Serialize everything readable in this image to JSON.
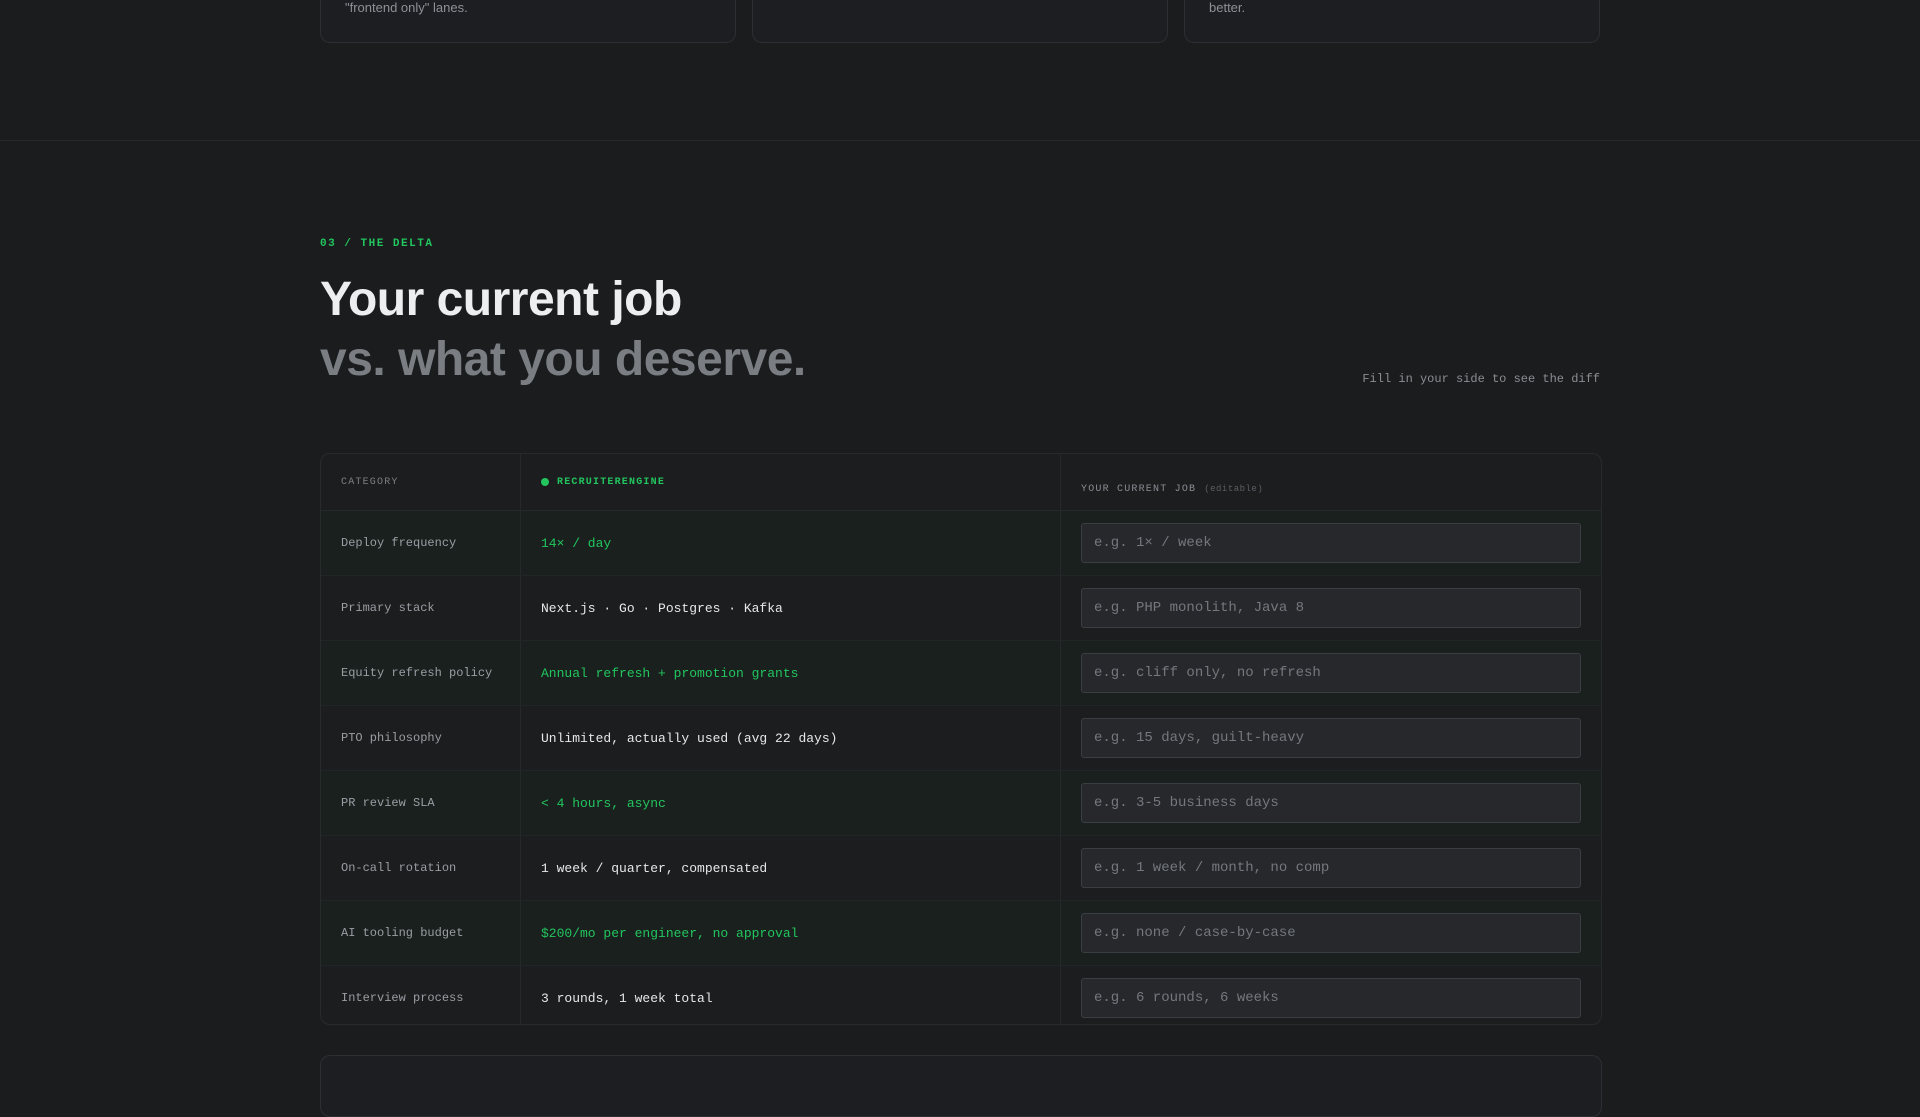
{
  "top_cards": [
    {
      "text": "\"frontend only\" lanes."
    },
    {
      "text": ""
    },
    {
      "text": "better."
    }
  ],
  "section": {
    "eyebrow": "03 / THE DELTA",
    "title_line1": "Your current job",
    "title_line2": "vs. what you deserve.",
    "hint": "Fill in your side to see the diff"
  },
  "table": {
    "headers": {
      "category": "CATEGORY",
      "company": "RECRUITERENGINE",
      "yours": "YOUR CURRENT JOB",
      "editable_tag": "(editable)"
    },
    "rows": [
      {
        "category": "Deploy frequency",
        "value": "14× / day",
        "placeholder": "e.g. 1× / week"
      },
      {
        "category": "Primary stack",
        "value": "Next.js · Go · Postgres · Kafka",
        "placeholder": "e.g. PHP monolith, Java 8"
      },
      {
        "category": "Equity refresh policy",
        "value": "Annual refresh + promotion grants",
        "placeholder": "e.g. cliff only, no refresh"
      },
      {
        "category": "PTO philosophy",
        "value": "Unlimited, actually used (avg 22 days)",
        "placeholder": "e.g. 15 days, guilt-heavy"
      },
      {
        "category": "PR review SLA",
        "value": "< 4 hours, async",
        "placeholder": "e.g. 3-5 business days"
      },
      {
        "category": "On-call rotation",
        "value": "1 week / quarter, compensated",
        "placeholder": "e.g. 1 week / month, no comp"
      },
      {
        "category": "AI tooling budget",
        "value": "$200/mo per engineer, no approval",
        "placeholder": "e.g. none / case-by-case"
      },
      {
        "category": "Interview process",
        "value": "3 rounds, 1 week total",
        "placeholder": "e.g. 6 rounds, 6 weeks"
      }
    ]
  },
  "colors": {
    "accent": "#22c55e",
    "background": "#1a1c1e"
  }
}
